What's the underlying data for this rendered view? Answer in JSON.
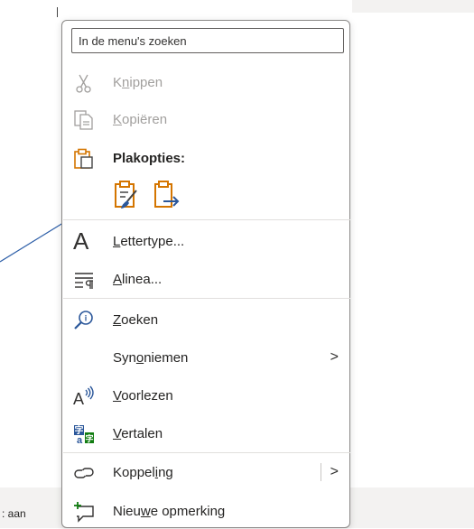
{
  "status": {
    "text": ": aan"
  },
  "menu": {
    "search_placeholder": "In de menu's zoeken",
    "items": {
      "cut": {
        "pre": "K",
        "u": "n",
        "post": "ippen"
      },
      "copy": {
        "pre": "",
        "u": "K",
        "post": "opiëren"
      },
      "paste_header": "Plakopties:",
      "font": {
        "pre": "",
        "u": "L",
        "post": "ettertype..."
      },
      "paragraph": {
        "pre": "",
        "u": "A",
        "post": "linea..."
      },
      "search": {
        "pre": "",
        "u": "Z",
        "post": "oeken"
      },
      "synonyms": {
        "pre": "Syn",
        "u": "o",
        "post": "niemen"
      },
      "read_aloud": {
        "pre": "",
        "u": "V",
        "post": "oorlezen"
      },
      "translate": {
        "pre": "",
        "u": "V",
        "post": "ertalen"
      },
      "link": {
        "pre": "Koppel",
        "u": "i",
        "post": "ng"
      },
      "comment": {
        "pre": "Nieu",
        "u": "w",
        "post": "e opmerking"
      }
    },
    "chevron": ">"
  },
  "colors": {
    "accent": "#2b579a",
    "paste_orange": "#d47500",
    "arrow": "#2e5fa8"
  }
}
